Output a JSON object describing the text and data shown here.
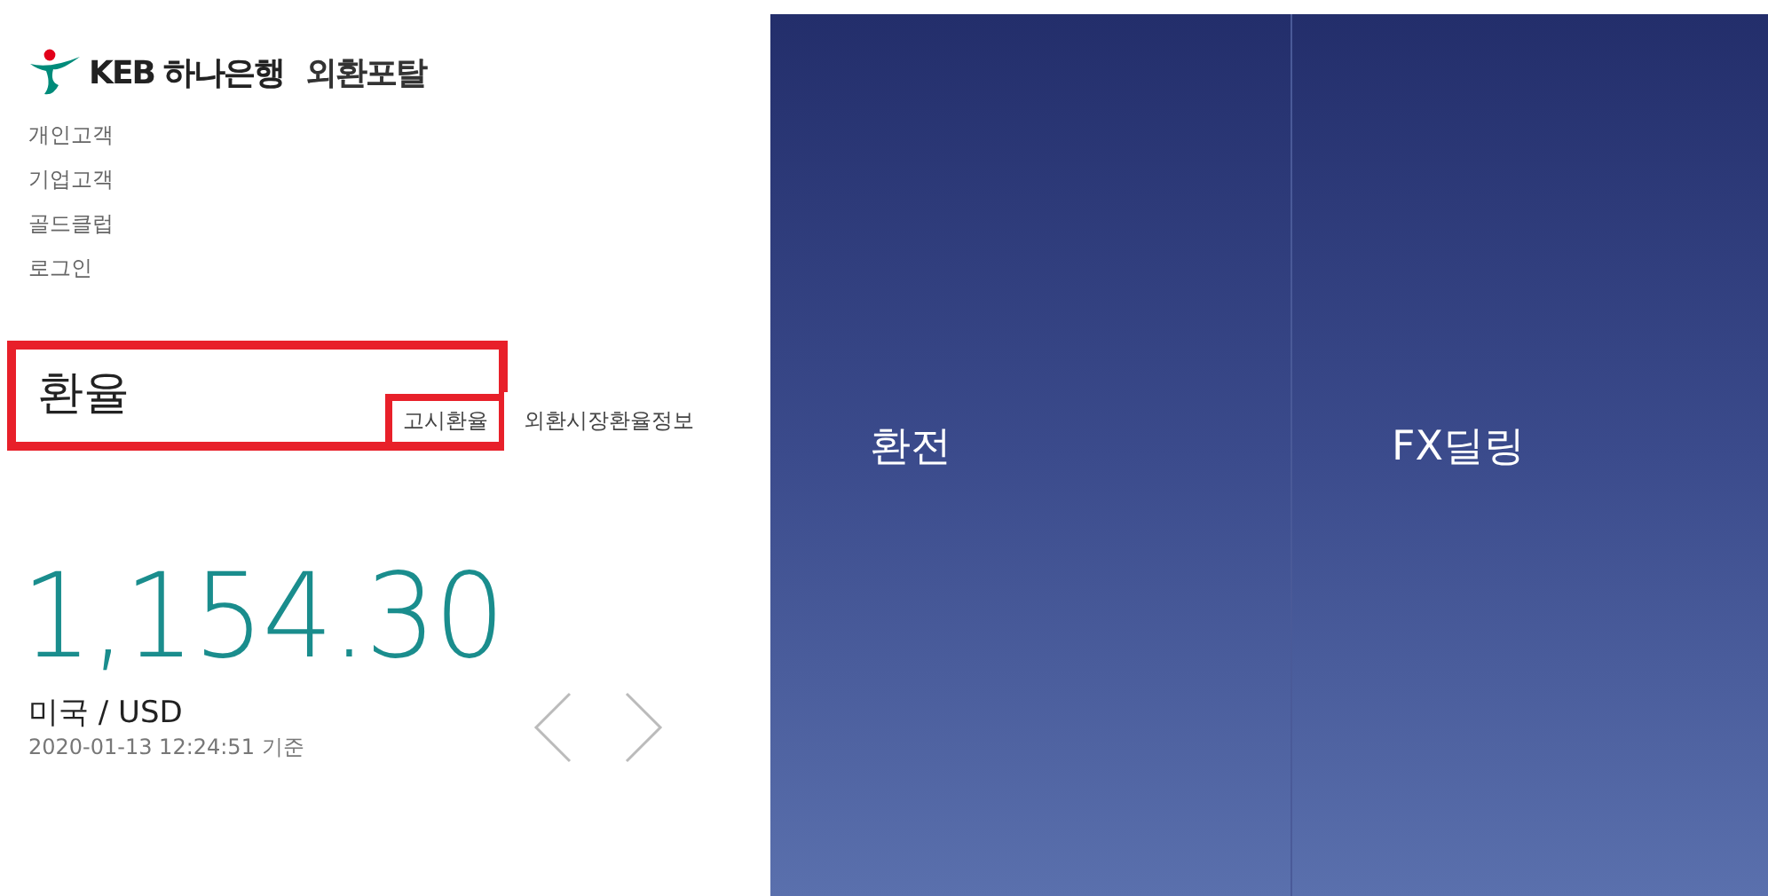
{
  "logo": {
    "brand": "KEB 하나은행",
    "service": "외환포탈"
  },
  "nav": [
    "개인고객",
    "기업고객",
    "골드클럽",
    "로그인"
  ],
  "rate": {
    "title": "환율",
    "tabs": [
      {
        "label": "고시환율",
        "selected": true
      },
      {
        "label": "외환시장환율정보",
        "selected": false
      }
    ],
    "value": "1,154.30",
    "currency": "미국 / USD",
    "timestamp": "2020-01-13 12:24:51 기준"
  },
  "panels": [
    {
      "label": "환전"
    },
    {
      "label": "FX딜링"
    }
  ]
}
